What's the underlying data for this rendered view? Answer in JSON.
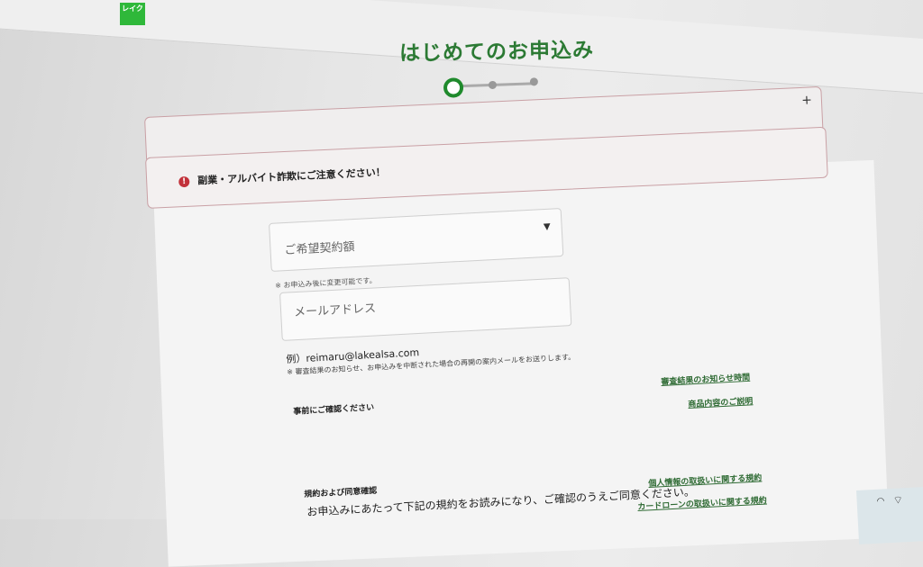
{
  "header": {
    "logo_text": "レイク"
  },
  "page": {
    "title": "はじめてのお申込み"
  },
  "stepper": {
    "current_step": 1,
    "total_steps": 3
  },
  "notice_collapsed": {
    "toggle": "+"
  },
  "alert": {
    "icon": "!",
    "text": "副業・アルバイト詐欺にご注意ください！"
  },
  "form": {
    "amount_select": {
      "label": "ご希望契約額"
    },
    "amount_hint": "※ お申込み後に変更可能です。",
    "email": {
      "placeholder": "メールアドレス"
    },
    "email_example": "例）reimaru@lakealsa.com",
    "email_hint": "※ 審査結果のお知らせ、お申込みを中断された場合の再開の案内メールをお送りします。"
  },
  "precheck": {
    "label": "事前にご確認ください",
    "links": [
      "審査結果のお知らせ時間",
      "商品内容のご説明"
    ]
  },
  "terms": {
    "label": "規約および同意確認",
    "text": "お申込みにあたって下記の規約をお読みになり、ご確認のうえご同意ください。",
    "links": [
      "個人情報の取扱いに関する規約",
      "カードローンの取扱いに関する規約"
    ]
  },
  "taskbar": {
    "icons": [
      "notification-icon",
      "wifi-icon"
    ]
  }
}
